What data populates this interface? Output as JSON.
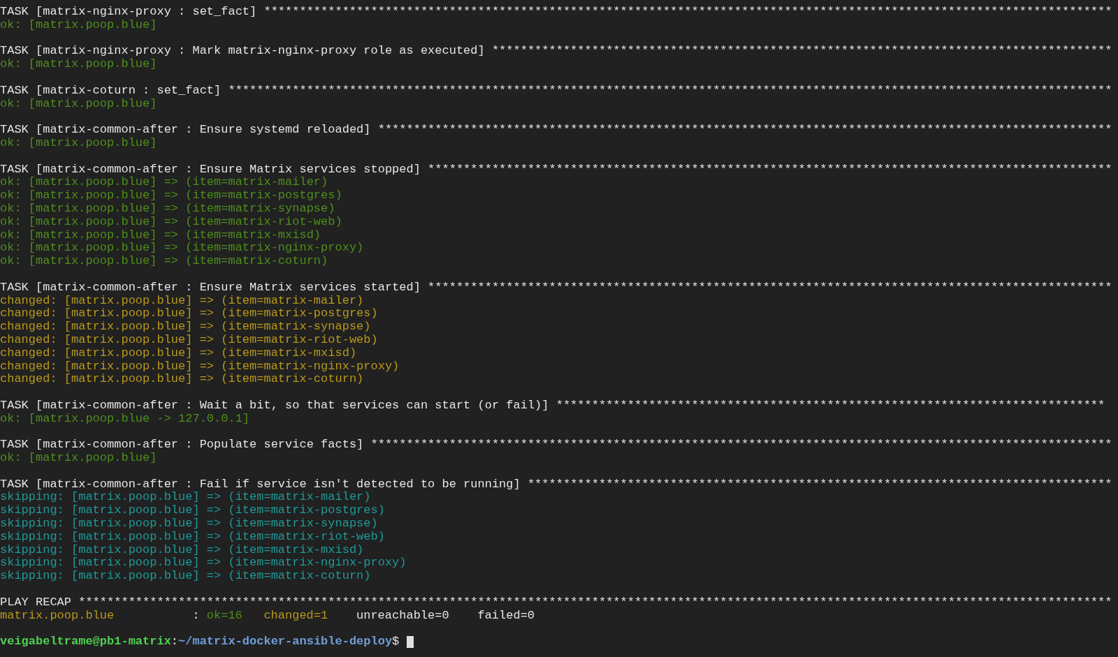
{
  "blocks": [
    {
      "title": "TASK [matrix-nginx-proxy : set_fact]",
      "rule": "***********************************************************************************************************************",
      "lines": [
        {
          "kind": "ok",
          "text": "ok: [matrix.poop.blue]"
        }
      ]
    },
    {
      "title": "TASK [matrix-nginx-proxy : Mark matrix-nginx-proxy role as executed]",
      "rule": "***************************************************************************************",
      "lines": [
        {
          "kind": "ok",
          "text": "ok: [matrix.poop.blue]"
        }
      ]
    },
    {
      "title": "TASK [matrix-coturn : set_fact]",
      "rule": "****************************************************************************************************************************",
      "lines": [
        {
          "kind": "ok",
          "text": "ok: [matrix.poop.blue]"
        }
      ]
    },
    {
      "title": "TASK [matrix-common-after : Ensure systemd reloaded]",
      "rule": "*******************************************************************************************************",
      "lines": [
        {
          "kind": "ok",
          "text": "ok: [matrix.poop.blue]"
        }
      ]
    },
    {
      "title": "TASK [matrix-common-after : Ensure Matrix services stopped]",
      "rule": "************************************************************************************************",
      "lines": [
        {
          "kind": "ok",
          "text": "ok: [matrix.poop.blue] => (item=matrix-mailer)"
        },
        {
          "kind": "ok",
          "text": "ok: [matrix.poop.blue] => (item=matrix-postgres)"
        },
        {
          "kind": "ok",
          "text": "ok: [matrix.poop.blue] => (item=matrix-synapse)"
        },
        {
          "kind": "ok",
          "text": "ok: [matrix.poop.blue] => (item=matrix-riot-web)"
        },
        {
          "kind": "ok",
          "text": "ok: [matrix.poop.blue] => (item=matrix-mxisd)"
        },
        {
          "kind": "ok",
          "text": "ok: [matrix.poop.blue] => (item=matrix-nginx-proxy)"
        },
        {
          "kind": "ok",
          "text": "ok: [matrix.poop.blue] => (item=matrix-coturn)"
        }
      ]
    },
    {
      "title": "TASK [matrix-common-after : Ensure Matrix services started]",
      "rule": "************************************************************************************************",
      "lines": [
        {
          "kind": "changed",
          "text": "changed: [matrix.poop.blue] => (item=matrix-mailer)"
        },
        {
          "kind": "changed",
          "text": "changed: [matrix.poop.blue] => (item=matrix-postgres)"
        },
        {
          "kind": "changed",
          "text": "changed: [matrix.poop.blue] => (item=matrix-synapse)"
        },
        {
          "kind": "changed",
          "text": "changed: [matrix.poop.blue] => (item=matrix-riot-web)"
        },
        {
          "kind": "changed",
          "text": "changed: [matrix.poop.blue] => (item=matrix-mxisd)"
        },
        {
          "kind": "changed",
          "text": "changed: [matrix.poop.blue] => (item=matrix-nginx-proxy)"
        },
        {
          "kind": "changed",
          "text": "changed: [matrix.poop.blue] => (item=matrix-coturn)"
        }
      ]
    },
    {
      "title": "TASK [matrix-common-after : Wait a bit, so that services can start (or fail)]",
      "rule": "*****************************************************************************",
      "lines": [
        {
          "kind": "ok",
          "text": "ok: [matrix.poop.blue -> 127.0.0.1]"
        }
      ]
    },
    {
      "title": "TASK [matrix-common-after : Populate service facts]",
      "rule": "********************************************************************************************************",
      "lines": [
        {
          "kind": "ok",
          "text": "ok: [matrix.poop.blue]"
        }
      ]
    },
    {
      "title": "TASK [matrix-common-after : Fail if service isn't detected to be running]",
      "rule": "**********************************************************************************",
      "lines": [
        {
          "kind": "skipping",
          "text": "skipping: [matrix.poop.blue] => (item=matrix-mailer)"
        },
        {
          "kind": "skipping",
          "text": "skipping: [matrix.poop.blue] => (item=matrix-postgres)"
        },
        {
          "kind": "skipping",
          "text": "skipping: [matrix.poop.blue] => (item=matrix-synapse)"
        },
        {
          "kind": "skipping",
          "text": "skipping: [matrix.poop.blue] => (item=matrix-riot-web)"
        },
        {
          "kind": "skipping",
          "text": "skipping: [matrix.poop.blue] => (item=matrix-mxisd)"
        },
        {
          "kind": "skipping",
          "text": "skipping: [matrix.poop.blue] => (item=matrix-nginx-proxy)"
        },
        {
          "kind": "skipping",
          "text": "skipping: [matrix.poop.blue] => (item=matrix-coturn)"
        }
      ]
    }
  ],
  "recap": {
    "title": "PLAY RECAP",
    "rule": "*************************************************************************************************************************************************",
    "parts": [
      {
        "kind": "changed",
        "text": "matrix.poop.blue"
      },
      {
        "kind": "plain",
        "text": ":"
      },
      {
        "kind": "ok",
        "text": "ok=16"
      },
      {
        "kind": "changed",
        "text": "changed=1"
      },
      {
        "kind": "plain",
        "text": "unreachable=0"
      },
      {
        "kind": "plain",
        "text": "failed=0"
      }
    ]
  },
  "prompt": {
    "user_host": "veigabeltrame@pb1-matrix",
    "separator": ":",
    "path": "~/matrix-docker-ansible-deploy",
    "symbol": "$"
  }
}
